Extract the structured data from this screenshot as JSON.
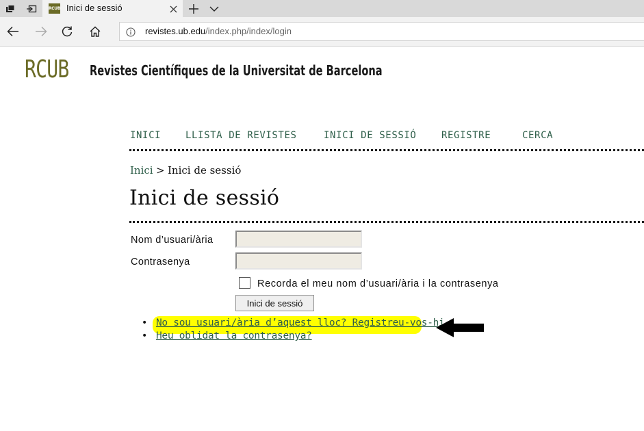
{
  "browser": {
    "tab": {
      "favicon_text": "RCUB",
      "title": "Inici de sessió"
    },
    "url": {
      "host": "revistes.ub.edu",
      "path": "/index.php/index/login"
    },
    "icons": [
      "tab-list-icon",
      "set-aside-tabs-icon",
      "close-icon",
      "new-tab-icon",
      "chevron-down-icon",
      "back-icon",
      "forward-icon",
      "refresh-icon",
      "home-icon",
      "info-icon"
    ]
  },
  "site": {
    "logo": "RCUB",
    "title": "Revistes Científiques de la Universitat de Barcelona"
  },
  "nav": {
    "items": [
      {
        "label": "INICI"
      },
      {
        "label": "LLISTA DE REVISTES"
      },
      {
        "label": "INICI DE SESSIÓ"
      },
      {
        "label": "REGISTRE"
      },
      {
        "label": "CERCA"
      }
    ]
  },
  "breadcrumb": {
    "home": "Inici",
    "separator": ">",
    "current": "Inici de sessió"
  },
  "page": {
    "title": "Inici de sessió"
  },
  "form": {
    "username_label": "Nom d’usuari/ària",
    "username_value": "",
    "password_label": "Contrasenya",
    "password_value": "",
    "remember_label": "Recorda el meu nom d’usuari/ària i la contrasenya",
    "remember_checked": false,
    "submit_label": "Inici de sessió"
  },
  "links": {
    "register": "No sou usuari/ària d’aquest lloc? Registreu-vos-hi.",
    "forgot": "Heu oblidat la contrasenya?"
  },
  "colors": {
    "brand": "#6b6b26",
    "link": "#2f5f4a",
    "highlight": "#ffff00",
    "annotation_arrow": "#000000"
  }
}
